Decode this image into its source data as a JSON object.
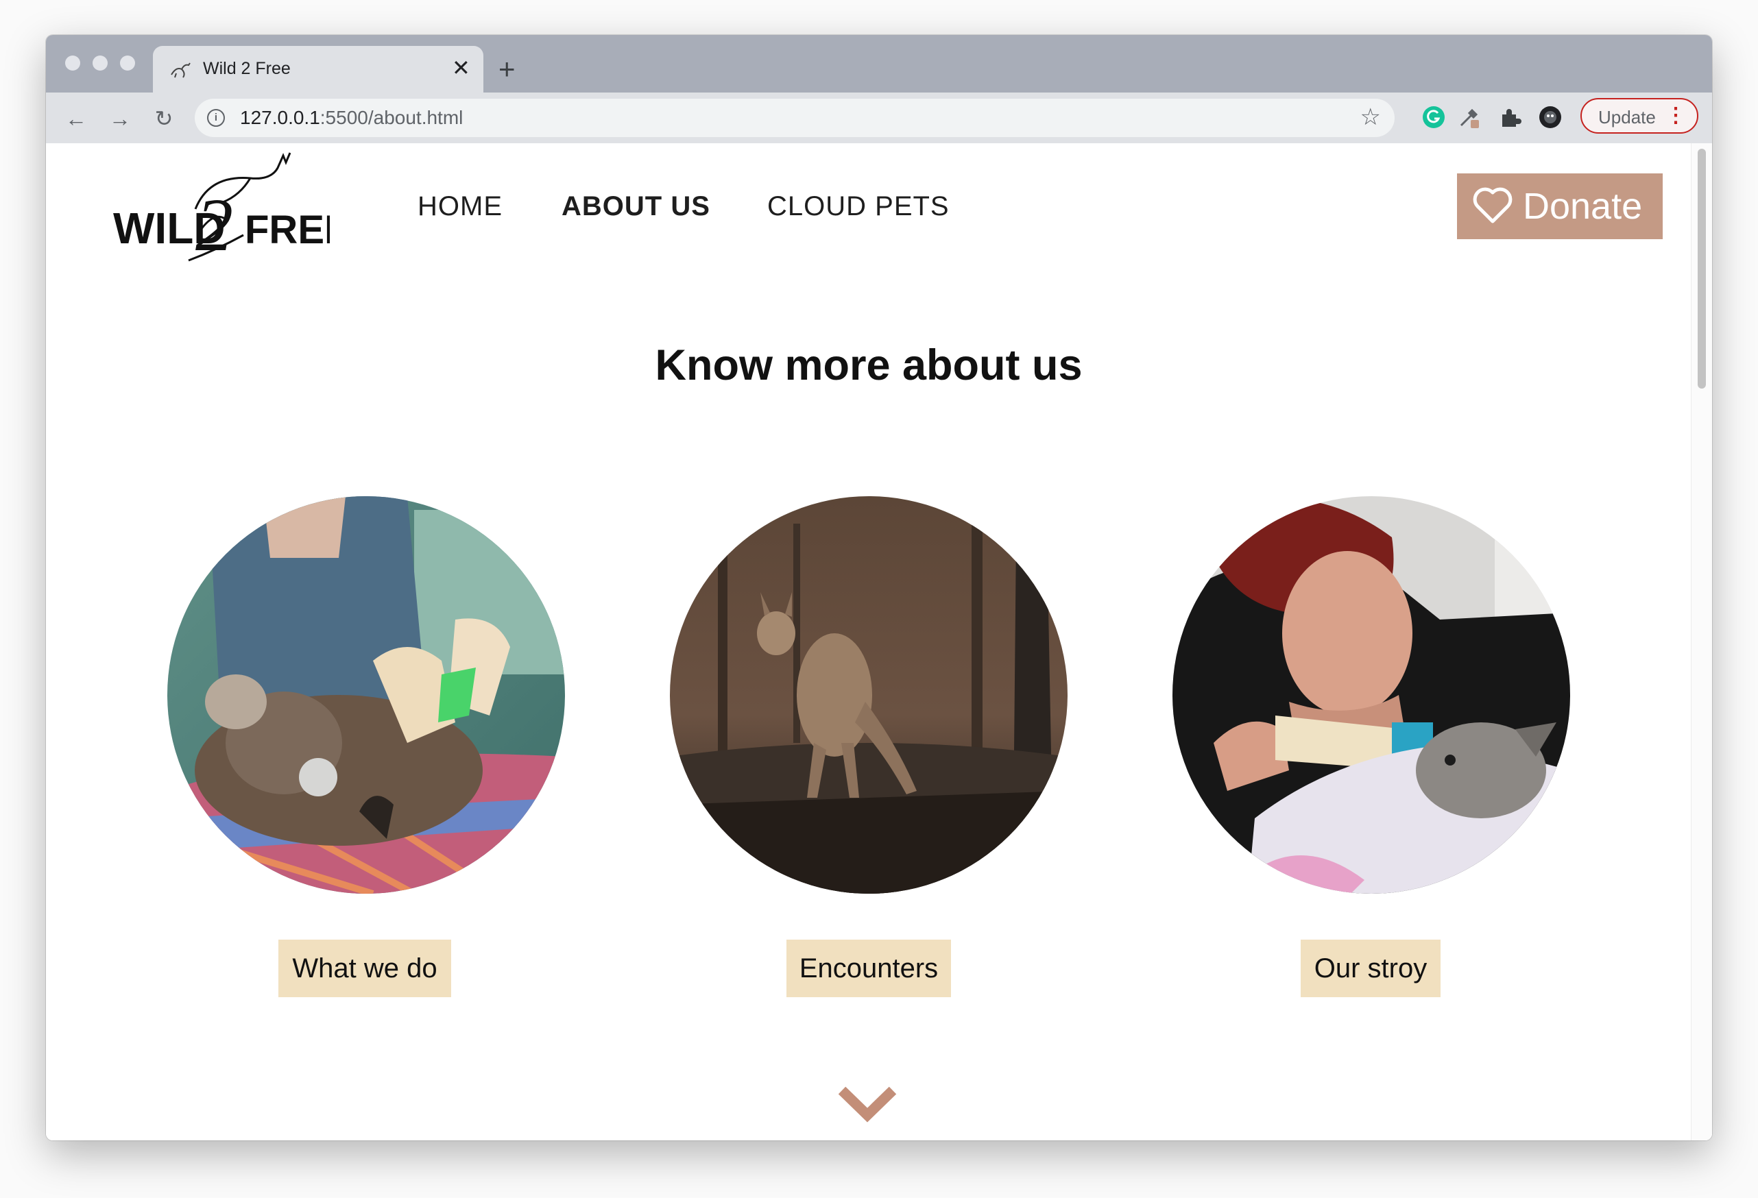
{
  "browser": {
    "tab": {
      "title": "Wild 2 Free",
      "close_glyph": "✕"
    },
    "new_tab_glyph": "+",
    "url": {
      "host": "127.0.0.1",
      "path": ":5500/about.html"
    },
    "update_label": "Update",
    "nav_glyphs": {
      "back": "←",
      "forward": "→",
      "reload": "↻"
    },
    "star_glyph": "☆",
    "info_glyph": "i",
    "menu_glyph": "⋮"
  },
  "header": {
    "logo_text": {
      "wild": "WILD",
      "two": "2",
      "free": "FREE"
    },
    "nav": [
      {
        "label": "HOME",
        "active": false
      },
      {
        "label": "ABOUT US",
        "active": true
      },
      {
        "label": "CLOUD PETS",
        "active": false
      }
    ],
    "donate_label": "Donate",
    "donate_color": "#c49a85"
  },
  "main": {
    "heading": "Know more about us",
    "cards": [
      {
        "label": "What we do",
        "image": "koala-treatment-photo"
      },
      {
        "label": "Encounters",
        "image": "kangaroo-burnt-forest-photo"
      },
      {
        "label": "Our stroy",
        "image": "joey-bottle-feeding-photo"
      }
    ],
    "label_bg": "#f1e0bf",
    "scroll_icon": "chevron-down-icon"
  }
}
